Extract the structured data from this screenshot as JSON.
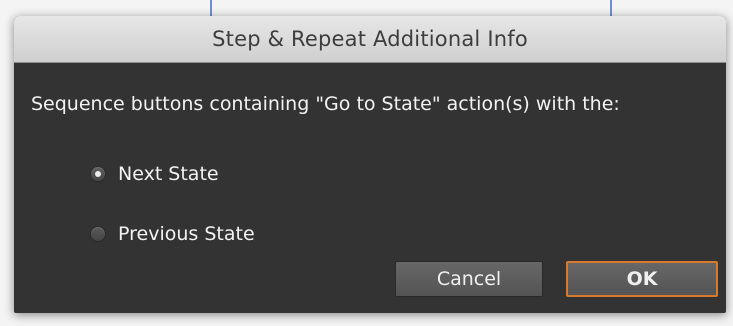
{
  "dialog": {
    "title": "Step & Repeat Additional Info",
    "prompt": "Sequence buttons containing \"Go to State\" action(s) with the:",
    "options": [
      {
        "label": "Next State",
        "selected": true
      },
      {
        "label": "Previous State",
        "selected": false
      }
    ],
    "buttons": {
      "cancel": "Cancel",
      "ok": "OK"
    },
    "colors": {
      "default_button_outline": "#d77a2c",
      "dialog_background": "#333333"
    }
  }
}
